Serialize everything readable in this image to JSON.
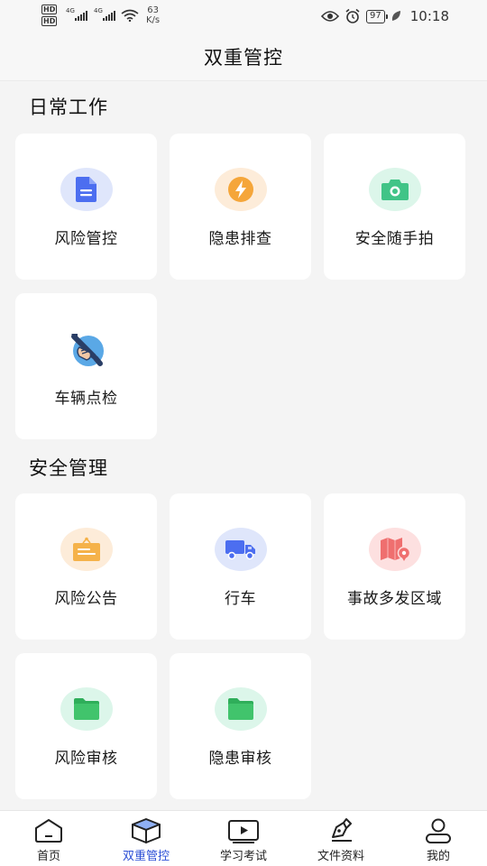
{
  "status_bar": {
    "hd_badge": "HD",
    "net_type_1": "4G",
    "net_type_2": "4G",
    "net_speed_value": "63",
    "net_speed_unit": "K/s",
    "battery": "97",
    "time": "10:18"
  },
  "header": {
    "title": "双重管控"
  },
  "sections": [
    {
      "title": "日常工作",
      "items": [
        {
          "label": "风险管控",
          "icon": "document-icon",
          "icon_bg": "#dfe6fb",
          "icon_color": "#4c6ef0"
        },
        {
          "label": "隐患排查",
          "icon": "lightning-icon",
          "icon_bg": "#fdecd9",
          "icon_color": "#f5a63a"
        },
        {
          "label": "安全随手拍",
          "icon": "camera-icon",
          "icon_bg": "#dcf6ea",
          "icon_color": "#41c487"
        },
        {
          "label": "车辆点检",
          "icon": "wrench-icon",
          "icon_bg": "transparent",
          "icon_color": "#3f8fd8"
        }
      ]
    },
    {
      "title": "安全管理",
      "items": [
        {
          "label": "风险公告",
          "icon": "notice-board-icon",
          "icon_bg": "#fdecd9",
          "icon_color": "#f5b24a"
        },
        {
          "label": "行车",
          "icon": "truck-icon",
          "icon_bg": "#dfe6fb",
          "icon_color": "#4c6ef0"
        },
        {
          "label": "事故多发区域",
          "icon": "map-pin-icon",
          "icon_bg": "#fde0e0",
          "icon_color": "#ef6f6f"
        },
        {
          "label": "风险审核",
          "icon": "folder-icon",
          "icon_bg": "#dcf6ea",
          "icon_color": "#41c46c"
        },
        {
          "label": "隐患审核",
          "icon": "folder-icon",
          "icon_bg": "#dcf6ea",
          "icon_color": "#41c46c"
        }
      ]
    }
  ],
  "bottom_nav": [
    {
      "label": "首页",
      "icon": "home-icon",
      "active": false
    },
    {
      "label": "双重管控",
      "icon": "cube-icon",
      "active": true
    },
    {
      "label": "学习考试",
      "icon": "video-play-icon",
      "active": false
    },
    {
      "label": "文件资料",
      "icon": "pen-document-icon",
      "active": false
    },
    {
      "label": "我的",
      "icon": "user-icon",
      "active": false
    }
  ],
  "colors": {
    "accent": "#2c4fd6",
    "background": "#f4f4f4",
    "card": "#ffffff"
  }
}
